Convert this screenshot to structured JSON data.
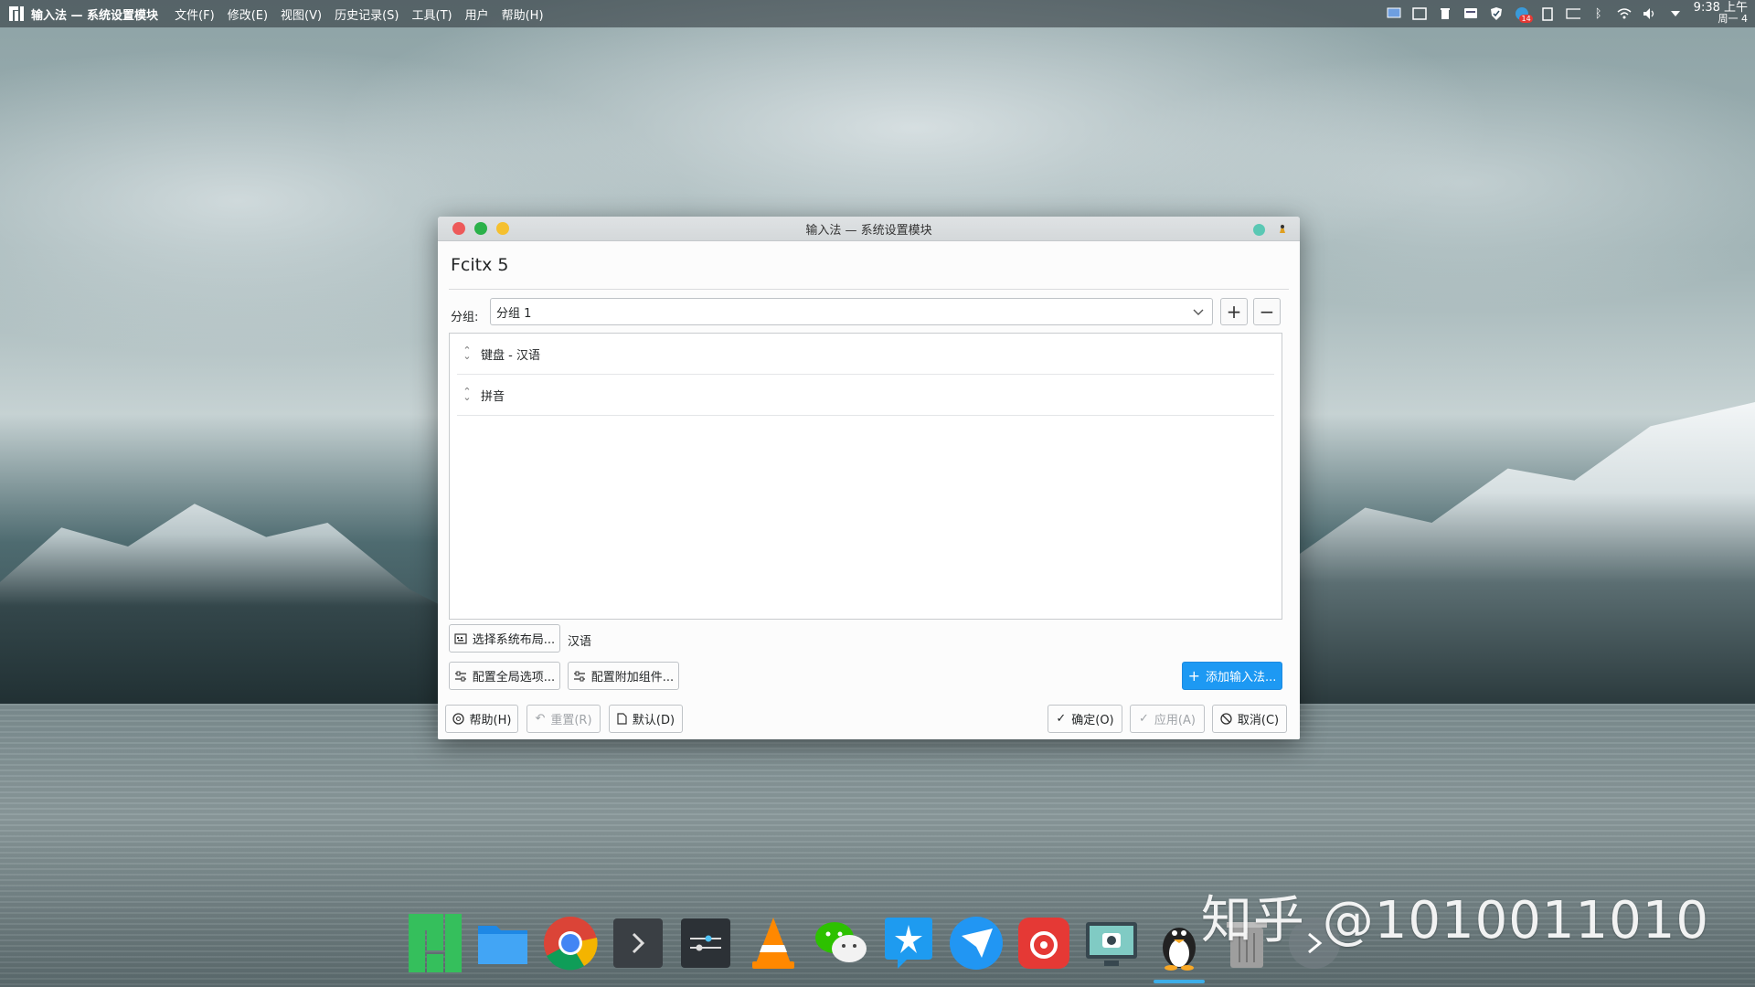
{
  "top_panel": {
    "app_title": "输入法 — 系统设置模块",
    "menus": [
      "文件(F)",
      "修改(E)",
      "视图(V)",
      "历史记录(S)",
      "工具(T)",
      "用户",
      "帮助(H)"
    ],
    "tray_badge": "14",
    "clock_time": "9:38 上午",
    "clock_day": "周一 4"
  },
  "window": {
    "title": "输入法 — 系统设置模块",
    "heading": "Fcitx 5",
    "group_label": "分组:",
    "group_value": "分组 1",
    "add_group_label": "+",
    "remove_group_label": "−",
    "input_methods": [
      {
        "label": "键盘 - 汉语"
      },
      {
        "label": "拼音"
      }
    ],
    "select_layout_label": "选择系统布局...",
    "layout_value": "汉语",
    "global_options_label": "配置全局选项...",
    "addons_label": "配置附加组件...",
    "add_im_label": "添加输入法...",
    "help_label": "帮助(H)",
    "reset_label": "重置(R)",
    "default_label": "默认(D)",
    "ok_label": "确定(O)",
    "apply_label": "应用(A)",
    "cancel_label": "取消(C)"
  },
  "dock": {
    "apps": [
      "manjaro-logo-icon",
      "file-manager-icon",
      "chrome-icon",
      "terminal-icon",
      "settings-icon",
      "vlc-icon",
      "wechat-icon",
      "dingtalk-icon",
      "feishu-icon",
      "netease-music-icon",
      "screenshot-icon",
      "qq-penguin-icon",
      "trash-icon",
      "next-icon"
    ]
  },
  "watermark": "知乎 @1010011010",
  "colors": {
    "accent": "#1d99f3",
    "close": "#ed5a5a",
    "maximize": "#2bb14a",
    "minimize": "#f5c02f"
  }
}
